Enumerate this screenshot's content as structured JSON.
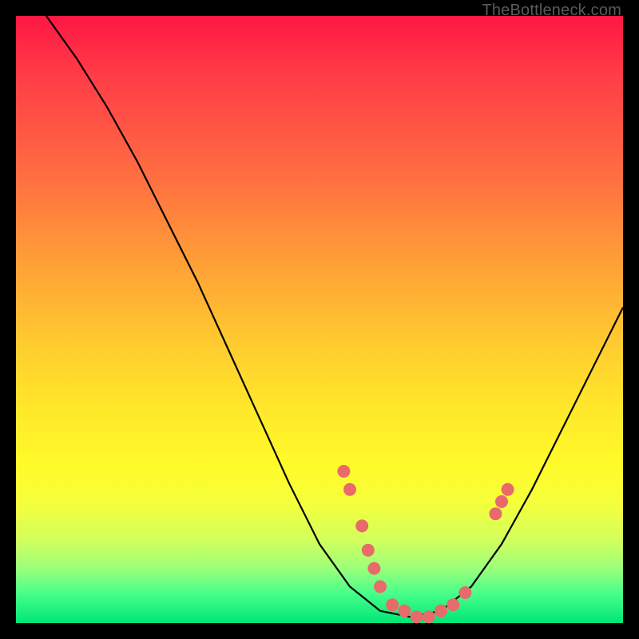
{
  "watermark": "TheBottleneck.com",
  "chart_data": {
    "type": "line",
    "title": "",
    "xlabel": "",
    "ylabel": "",
    "xlim": [
      0,
      100
    ],
    "ylim": [
      0,
      100
    ],
    "curve": [
      {
        "x": 5,
        "y": 100
      },
      {
        "x": 10,
        "y": 93
      },
      {
        "x": 15,
        "y": 85
      },
      {
        "x": 20,
        "y": 76
      },
      {
        "x": 25,
        "y": 66
      },
      {
        "x": 30,
        "y": 56
      },
      {
        "x": 35,
        "y": 45
      },
      {
        "x": 40,
        "y": 34
      },
      {
        "x": 45,
        "y": 23
      },
      {
        "x": 50,
        "y": 13
      },
      {
        "x": 55,
        "y": 6
      },
      {
        "x": 60,
        "y": 2
      },
      {
        "x": 65,
        "y": 1
      },
      {
        "x": 70,
        "y": 2
      },
      {
        "x": 75,
        "y": 6
      },
      {
        "x": 80,
        "y": 13
      },
      {
        "x": 85,
        "y": 22
      },
      {
        "x": 90,
        "y": 32
      },
      {
        "x": 95,
        "y": 42
      },
      {
        "x": 100,
        "y": 52
      }
    ],
    "markers": [
      {
        "x": 54,
        "y": 25
      },
      {
        "x": 55,
        "y": 22
      },
      {
        "x": 57,
        "y": 16
      },
      {
        "x": 58,
        "y": 12
      },
      {
        "x": 59,
        "y": 9
      },
      {
        "x": 60,
        "y": 6
      },
      {
        "x": 62,
        "y": 3
      },
      {
        "x": 64,
        "y": 2
      },
      {
        "x": 66,
        "y": 1
      },
      {
        "x": 68,
        "y": 1
      },
      {
        "x": 70,
        "y": 2
      },
      {
        "x": 72,
        "y": 3
      },
      {
        "x": 74,
        "y": 5
      },
      {
        "x": 79,
        "y": 18
      },
      {
        "x": 80,
        "y": 20
      },
      {
        "x": 81,
        "y": 22
      }
    ],
    "marker_color": "#e86a6a",
    "curve_color": "#000000"
  }
}
